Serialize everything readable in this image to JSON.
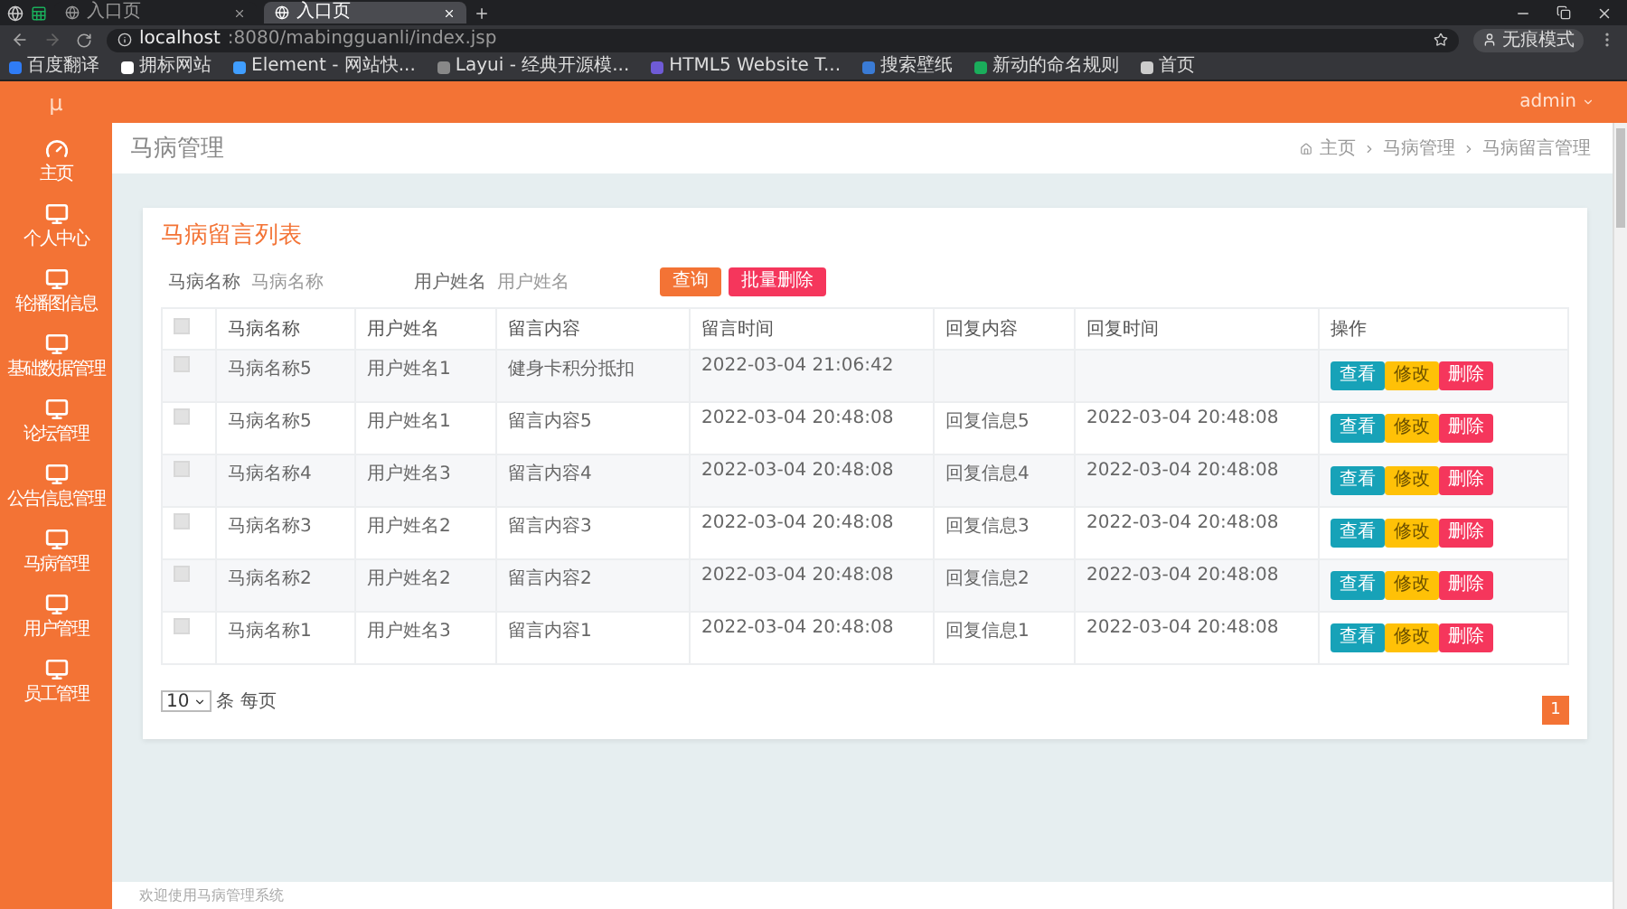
{
  "browser": {
    "tabs": [
      {
        "title": "入口页",
        "selected": false
      },
      {
        "title": "入口页",
        "selected": true
      }
    ],
    "address": {
      "host": "localhost",
      "path": ":8080/mabingguanli/index.jsp"
    },
    "bookmarks": [
      {
        "label": "百度翻译",
        "color": "#2f7cf6"
      },
      {
        "label": "拥标网站",
        "color": "#ffffff"
      },
      {
        "label": "Element - 网站快...",
        "color": "#409eff"
      },
      {
        "label": "Layui - 经典开源模...",
        "color": "#888888"
      },
      {
        "label": "HTML5 Website T...",
        "color": "#6f5bd6"
      },
      {
        "label": "搜索壁纸",
        "color": "#3a7bd5"
      },
      {
        "label": "新动的命名规则",
        "color": "#1aad5b"
      },
      {
        "label": "首页",
        "color": "#cccccc"
      }
    ],
    "profile": "无痕模式"
  },
  "header": {
    "logo": "μ",
    "user": "admin"
  },
  "sidebar": {
    "items": [
      {
        "label": "主页",
        "kind": "dashboard"
      },
      {
        "label": "个人中心",
        "kind": "monitor"
      },
      {
        "label": "轮播图信息",
        "kind": "monitor"
      },
      {
        "label": "基础数据管理",
        "kind": "monitor"
      },
      {
        "label": "论坛管理",
        "kind": "monitor"
      },
      {
        "label": "公告信息管理",
        "kind": "monitor"
      },
      {
        "label": "马病管理",
        "kind": "monitor"
      },
      {
        "label": "用户管理",
        "kind": "monitor"
      },
      {
        "label": "员工管理",
        "kind": "monitor"
      }
    ]
  },
  "page": {
    "title": "马病管理",
    "breadcrumb": [
      "主页",
      "马病管理",
      "马病留言管理"
    ]
  },
  "card": {
    "title": "马病留言列表",
    "filters": [
      {
        "label": "马病名称",
        "placeholder": "马病名称"
      },
      {
        "label": "用户姓名",
        "placeholder": "用户姓名"
      }
    ],
    "buttons": [
      {
        "label": "查询",
        "kind": "search"
      },
      {
        "label": "批量删除",
        "kind": "delete"
      }
    ]
  },
  "table": {
    "all_checked": false,
    "columns": [
      "马病名称",
      "用户姓名",
      "留言内容",
      "留言时间",
      "回复内容",
      "回复时间",
      "操作"
    ],
    "rows": [
      {
        "checked": false,
        "cells": [
          "马病名称5",
          "用户姓名1",
          "健身卡积分抵扣",
          "2022-03-04 21:06:42"
        ],
        "actions": [
          "查看",
          "修改",
          "删除"
        ]
      },
      {
        "checked": false,
        "cells": [
          "马病名称5",
          "用户姓名1",
          "留言内容5",
          "2022-03-04 20:48:08",
          "回复信息5",
          "2022-03-04 20:48:08"
        ],
        "actions": [
          "查看",
          "修改",
          "删除"
        ]
      },
      {
        "checked": false,
        "cells": [
          "马病名称4",
          "用户姓名3",
          "留言内容4",
          "2022-03-04 20:48:08",
          "回复信息4",
          "2022-03-04 20:48:08"
        ],
        "actions": [
          "查看",
          "修改",
          "删除"
        ]
      },
      {
        "checked": false,
        "cells": [
          "马病名称3",
          "用户姓名2",
          "留言内容3",
          "2022-03-04 20:48:08",
          "回复信息3",
          "2022-03-04 20:48:08"
        ],
        "actions": [
          "查看",
          "修改",
          "删除"
        ]
      },
      {
        "checked": false,
        "cells": [
          "马病名称2",
          "用户姓名2",
          "留言内容2",
          "2022-03-04 20:48:08",
          "回复信息2",
          "2022-03-04 20:48:08"
        ],
        "actions": [
          "查看",
          "修改",
          "删除"
        ]
      },
      {
        "checked": false,
        "cells": [
          "马病名称1",
          "用户姓名3",
          "留言内容1",
          "2022-03-04 20:48:08",
          "回复信息1",
          "2022-03-04 20:48:08"
        ],
        "actions": [
          "查看",
          "修改",
          "删除"
        ]
      }
    ]
  },
  "pager": {
    "page_size": "10",
    "per_page_label": "条 每页",
    "pages": [
      {
        "label": "1",
        "selected": true
      }
    ]
  },
  "footer": "欢迎使用马病管理系统"
}
